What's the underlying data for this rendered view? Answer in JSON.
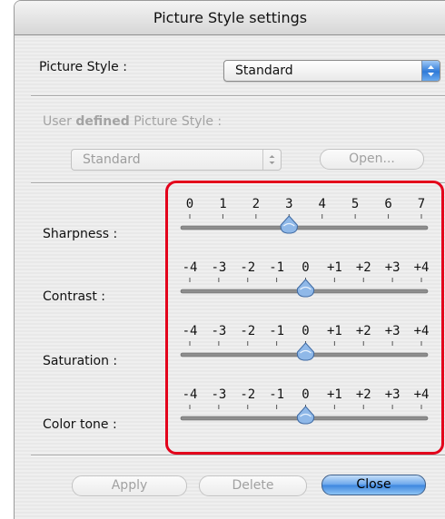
{
  "window": {
    "title": "Picture Style settings"
  },
  "picture_style": {
    "label": "Picture Style :",
    "selected": "Standard"
  },
  "user_defined": {
    "label_prefix": "User",
    "label_bold": "defined",
    "label_suffix": "Picture Style :",
    "selected": "Standard",
    "open_label": "Open..."
  },
  "sliders": [
    {
      "key": "sharpness",
      "label": "Sharpness :",
      "ticks": [
        "0",
        "1",
        "2",
        "3",
        "4",
        "5",
        "6",
        "7"
      ],
      "value": "3"
    },
    {
      "key": "contrast",
      "label": "Contrast :",
      "ticks": [
        "-4",
        "-3",
        "-2",
        "-1",
        "0",
        "+1",
        "+2",
        "+3",
        "+4"
      ],
      "value": "0"
    },
    {
      "key": "saturation",
      "label": "Saturation :",
      "ticks": [
        "-4",
        "-3",
        "-2",
        "-1",
        "0",
        "+1",
        "+2",
        "+3",
        "+4"
      ],
      "value": "0"
    },
    {
      "key": "color_tone",
      "label": "Color tone :",
      "ticks": [
        "-4",
        "-3",
        "-2",
        "-1",
        "0",
        "+1",
        "+2",
        "+3",
        "+4"
      ],
      "value": "0"
    }
  ],
  "buttons": {
    "apply": "Apply",
    "delete": "Delete",
    "close": "Close"
  },
  "colors": {
    "highlight": "#e3001b",
    "accent": "#3d86df",
    "thumb": "#8fb8e8"
  }
}
